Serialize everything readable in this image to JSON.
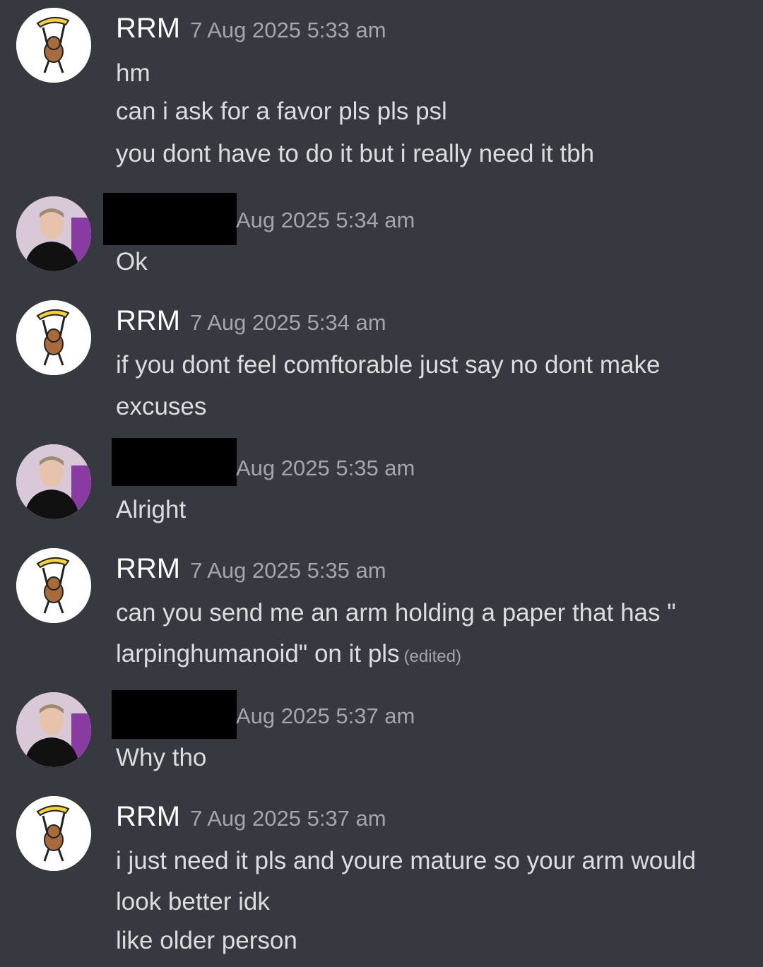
{
  "messages": [
    {
      "author": "RRM",
      "timestamp": "7 Aug 2025 5:33 am",
      "avatar": "monkey-banana-avatar",
      "lines": [
        "hm",
        "can i ask for a favor pls pls psl",
        "you dont have to do it but i really need it tbh"
      ]
    },
    {
      "author": "",
      "timestamp": "Aug 2025 5:34 am",
      "avatar": "person-photo-avatar",
      "lines": [
        "Ok"
      ]
    },
    {
      "author": "RRM",
      "timestamp": "7 Aug 2025 5:34 am",
      "avatar": "monkey-banana-avatar",
      "lines": [
        "if you dont feel comftorable just say no dont make",
        "excuses"
      ]
    },
    {
      "author": "",
      "timestamp": "Aug 2025 5:35 am",
      "avatar": "person-photo-avatar",
      "lines": [
        "Alright"
      ]
    },
    {
      "author": "RRM",
      "timestamp": "7 Aug 2025 5:35 am",
      "avatar": "monkey-banana-avatar",
      "lines": [
        "can you send me an arm holding a paper that has \"",
        "larpinghumanoid\" on it pls"
      ],
      "edited": "(edited)"
    },
    {
      "author": "",
      "timestamp": "Aug 2025 5:37 am",
      "avatar": "person-photo-avatar",
      "lines": [
        "Why tho"
      ]
    },
    {
      "author": "RRM",
      "timestamp": "7 Aug 2025 5:37 am",
      "avatar": "monkey-banana-avatar",
      "lines": [
        "i just need it pls and youre mature so your arm would",
        "look better idk",
        "like older person"
      ]
    }
  ]
}
